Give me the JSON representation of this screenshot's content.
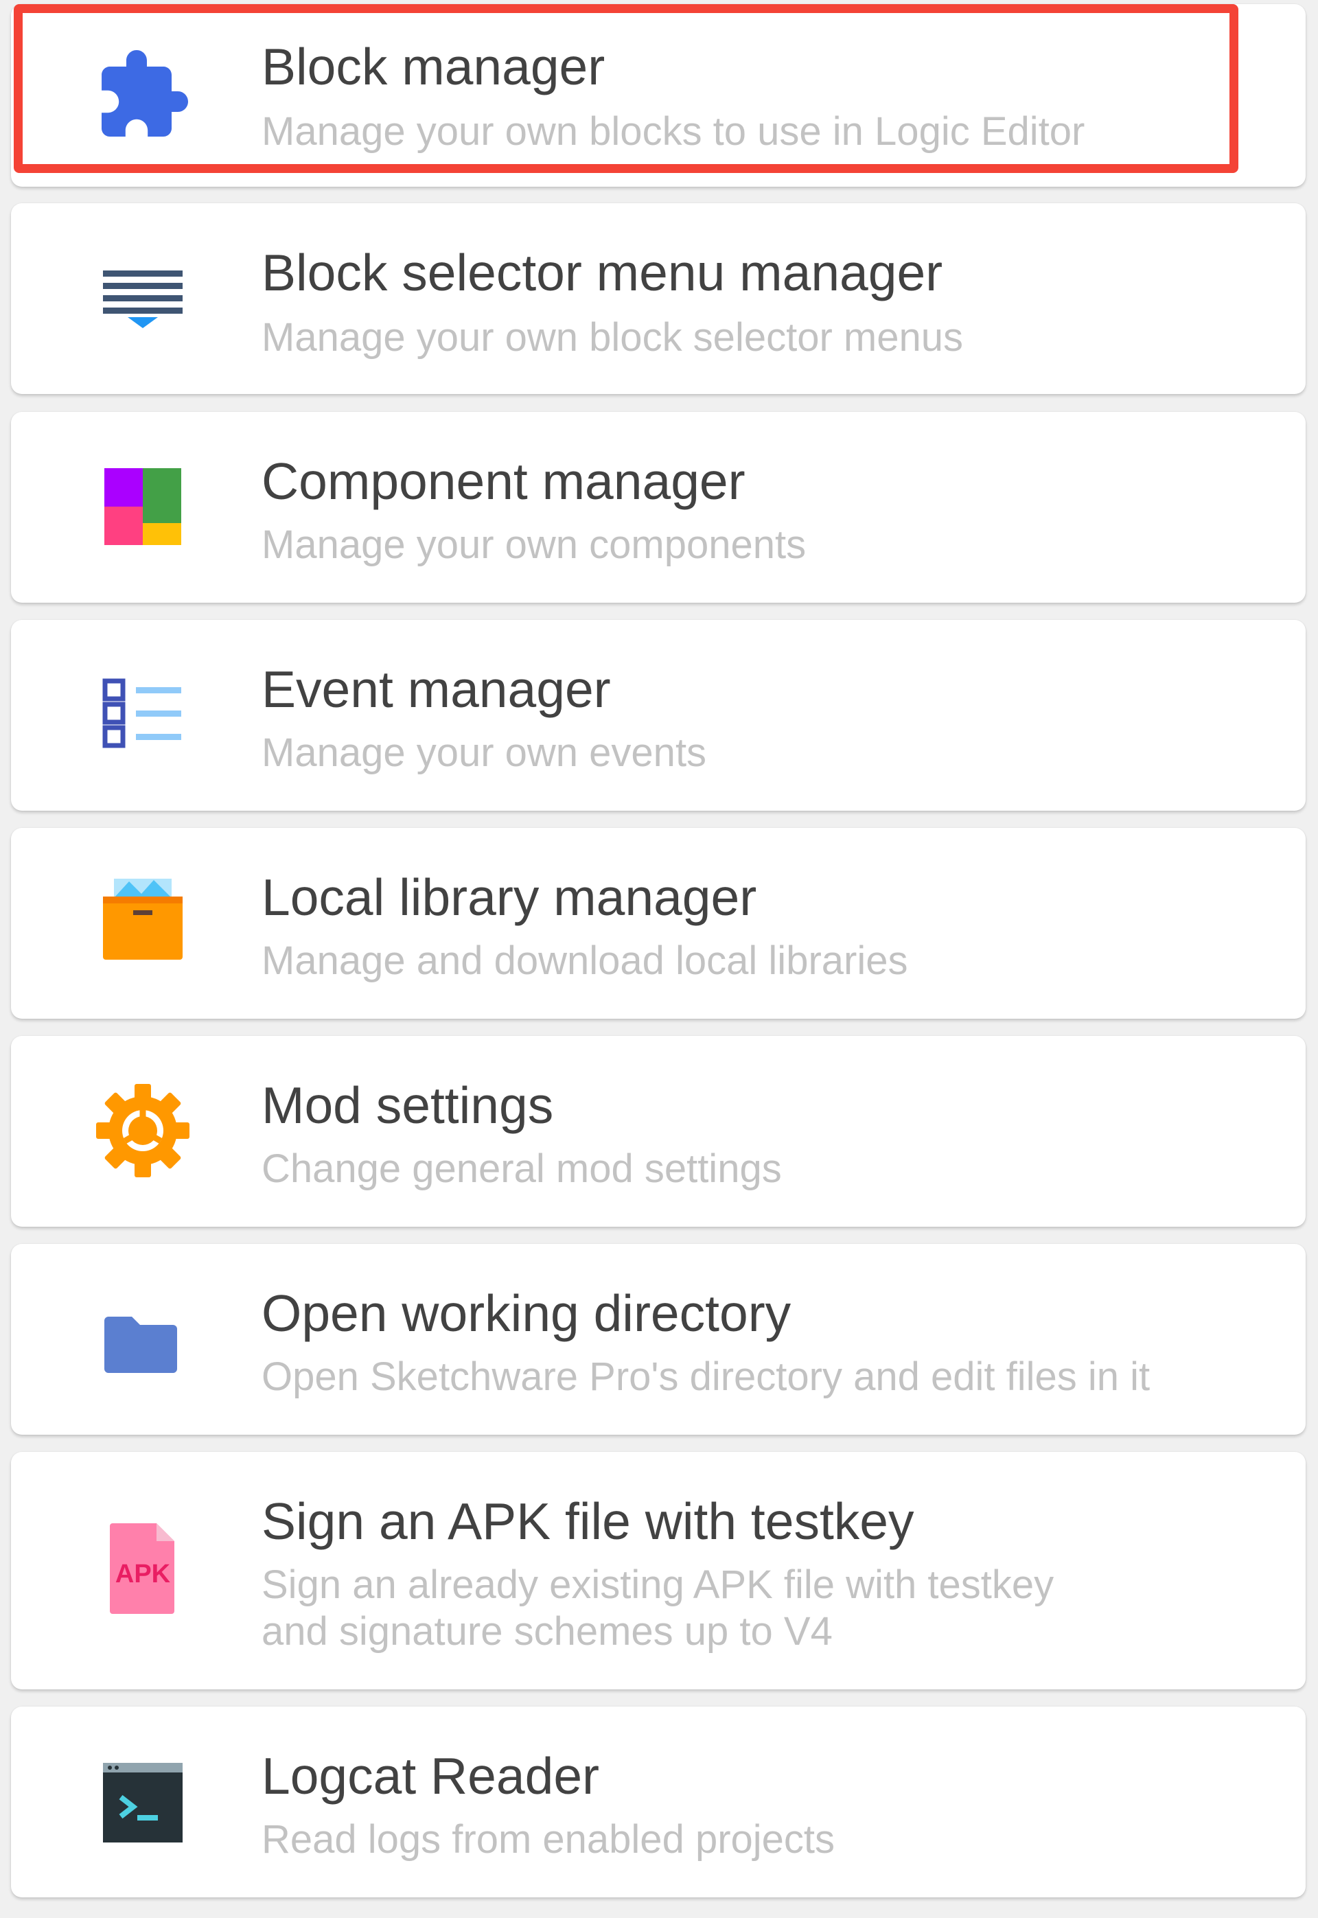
{
  "items": [
    {
      "title": "Block manager",
      "subtitle": "Manage your own blocks to use in Logic Editor",
      "icon": "puzzle-piece-icon",
      "highlighted": true
    },
    {
      "title": "Block selector menu manager",
      "subtitle": "Manage your own block selector menus",
      "icon": "menu-lines-dropdown-icon"
    },
    {
      "title": "Component manager",
      "subtitle": "Manage your own components",
      "icon": "colored-grid-icon"
    },
    {
      "title": "Event manager",
      "subtitle": "Manage your own events",
      "icon": "checklist-icon"
    },
    {
      "title": "Local library manager",
      "subtitle": "Manage and download local libraries",
      "icon": "archive-box-icon"
    },
    {
      "title": "Mod settings",
      "subtitle": "Change general mod settings",
      "icon": "gear-icon"
    },
    {
      "title": "Open working directory",
      "subtitle": "Open Sketchware Pro's directory and edit files in it",
      "icon": "folder-icon"
    },
    {
      "title": "Sign an APK file with testkey",
      "subtitle": "Sign an already existing APK file with testkey and signature schemes up to V4",
      "icon": "apk-file-icon",
      "icon_text": "APK"
    },
    {
      "title": "Logcat Reader",
      "subtitle": "Read logs from enabled projects",
      "icon": "terminal-icon"
    }
  ],
  "colors": {
    "highlight_border": "#f44336",
    "title_text": "#424242",
    "subtitle_text": "#c2c2c2",
    "card_background": "#ffffff",
    "page_background": "#f0f0f0"
  }
}
